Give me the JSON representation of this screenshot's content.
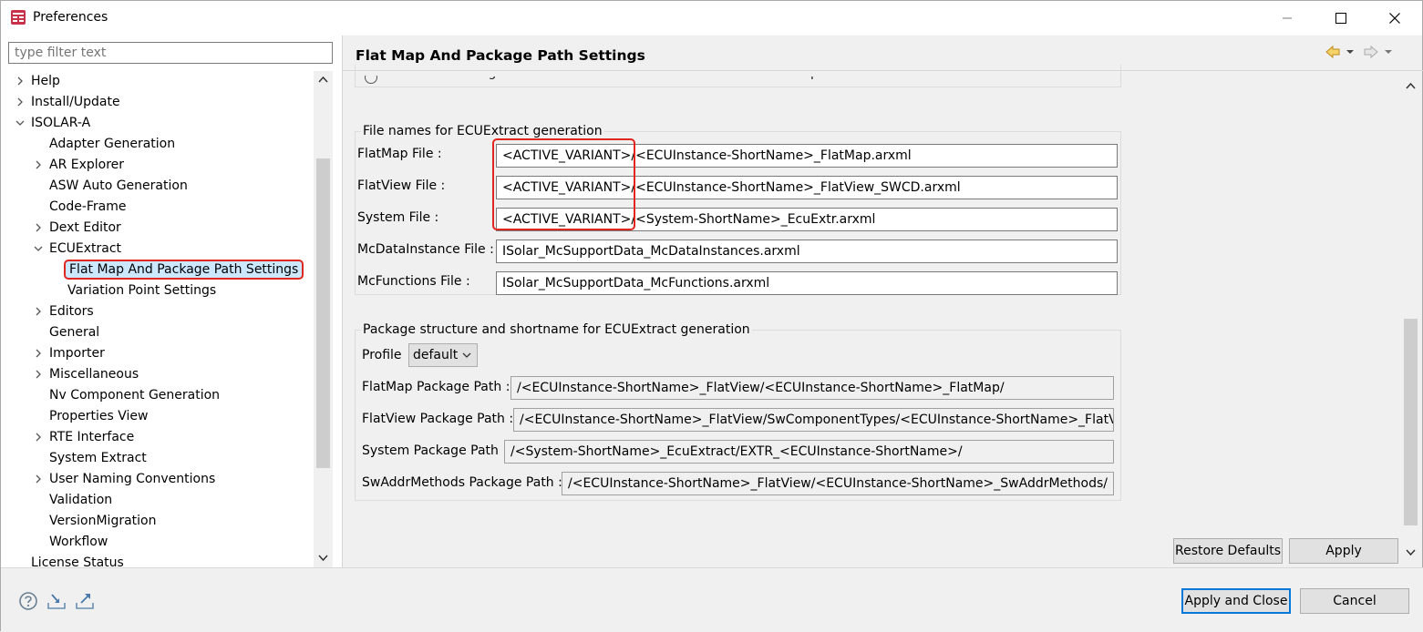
{
  "window": {
    "title": "Preferences"
  },
  "filter": {
    "placeholder": "type filter text"
  },
  "tree": [
    {
      "label": "Help",
      "level": 0,
      "expander": "collapsed"
    },
    {
      "label": "Install/Update",
      "level": 0,
      "expander": "collapsed"
    },
    {
      "label": "ISOLAR-A",
      "level": 0,
      "expander": "expanded"
    },
    {
      "label": "Adapter Generation",
      "level": 1,
      "expander": "none"
    },
    {
      "label": "AR Explorer",
      "level": 1,
      "expander": "collapsed"
    },
    {
      "label": "ASW Auto Generation",
      "level": 1,
      "expander": "none"
    },
    {
      "label": "Code-Frame",
      "level": 1,
      "expander": "none"
    },
    {
      "label": "Dext Editor",
      "level": 1,
      "expander": "collapsed"
    },
    {
      "label": "ECUExtract",
      "level": 1,
      "expander": "expanded"
    },
    {
      "label": "Flat Map And Package Path Settings",
      "level": 2,
      "expander": "none",
      "selected": true
    },
    {
      "label": "Variation Point Settings",
      "level": 2,
      "expander": "none"
    },
    {
      "label": "Editors",
      "level": 1,
      "expander": "collapsed"
    },
    {
      "label": "General",
      "level": 1,
      "expander": "none"
    },
    {
      "label": "Importer",
      "level": 1,
      "expander": "collapsed"
    },
    {
      "label": "Miscellaneous",
      "level": 1,
      "expander": "collapsed"
    },
    {
      "label": "Nv Component Generation",
      "level": 1,
      "expander": "none"
    },
    {
      "label": "Properties View",
      "level": 1,
      "expander": "none"
    },
    {
      "label": "RTE Interface",
      "level": 1,
      "expander": "collapsed"
    },
    {
      "label": "System Extract",
      "level": 1,
      "expander": "none"
    },
    {
      "label": "User Naming Conventions",
      "level": 1,
      "expander": "collapsed"
    },
    {
      "label": "Validation",
      "level": 1,
      "expander": "none"
    },
    {
      "label": "VersionMigration",
      "level": 1,
      "expander": "none"
    },
    {
      "label": "Workflow",
      "level": 1,
      "expander": "none"
    },
    {
      "label": "License Status",
      "level": 0,
      "expander": "none"
    }
  ],
  "page": {
    "title": "Flat Map And Package Path Settings",
    "clipped_option": "Consider Naming convention from Measurement and Calibration Spec"
  },
  "files_group": {
    "title": "File names for ECUExtract generation",
    "fields": [
      {
        "label": "FlatMap File :",
        "value": "<ACTIVE_VARIANT>/<ECUInstance-ShortName>_FlatMap.arxml"
      },
      {
        "label": "FlatView File :",
        "value": "<ACTIVE_VARIANT>/<ECUInstance-ShortName>_FlatView_SWCD.arxml"
      },
      {
        "label": "System File :",
        "value": "<ACTIVE_VARIANT>/<System-ShortName>_EcuExtr.arxml"
      },
      {
        "label": "McDataInstance File :",
        "value": "ISolar_McSupportData_McDataInstances.arxml"
      },
      {
        "label": "McFunctions File :",
        "value": "ISolar_McSupportData_McFunctions.arxml"
      }
    ]
  },
  "package_group": {
    "title": "Package structure and shortname for ECUExtract generation",
    "profile_label": "Profile",
    "profile_value": "default",
    "fields": [
      {
        "label": "FlatMap Package Path :",
        "value": "/<ECUInstance-ShortName>_FlatView/<ECUInstance-ShortName>_FlatMap/"
      },
      {
        "label": "FlatView Package Path :",
        "value": "/<ECUInstance-ShortName>_FlatView/SwComponentTypes/<ECUInstance-ShortName>_FlatView/"
      },
      {
        "label": "System Package Path :",
        "value": "/<System-ShortName>_EcuExtract/EXTR_<ECUInstance-ShortName>/"
      },
      {
        "label": "SwAddrMethods Package Path :",
        "value": "/<ECUInstance-ShortName>_FlatView/<ECUInstance-ShortName>_SwAddrMethods/"
      }
    ]
  },
  "buttons": {
    "restore_defaults": "Restore Defaults",
    "apply": "Apply",
    "apply_and_close": "Apply and Close",
    "cancel": "Cancel"
  },
  "colors": {
    "highlight_red": "#e0261f",
    "default_button_border": "#0078d7"
  }
}
